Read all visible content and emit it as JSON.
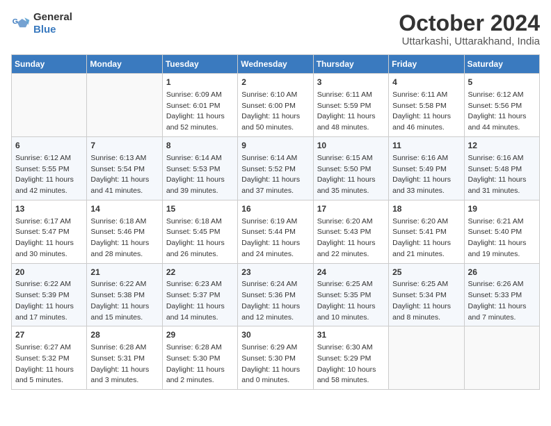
{
  "logo": {
    "line1": "General",
    "line2": "Blue"
  },
  "title": "October 2024",
  "location": "Uttarkashi, Uttarakhand, India",
  "headers": [
    "Sunday",
    "Monday",
    "Tuesday",
    "Wednesday",
    "Thursday",
    "Friday",
    "Saturday"
  ],
  "weeks": [
    [
      {
        "day": "",
        "info": ""
      },
      {
        "day": "",
        "info": ""
      },
      {
        "day": "1",
        "info": "Sunrise: 6:09 AM\nSunset: 6:01 PM\nDaylight: 11 hours and 52 minutes."
      },
      {
        "day": "2",
        "info": "Sunrise: 6:10 AM\nSunset: 6:00 PM\nDaylight: 11 hours and 50 minutes."
      },
      {
        "day": "3",
        "info": "Sunrise: 6:11 AM\nSunset: 5:59 PM\nDaylight: 11 hours and 48 minutes."
      },
      {
        "day": "4",
        "info": "Sunrise: 6:11 AM\nSunset: 5:58 PM\nDaylight: 11 hours and 46 minutes."
      },
      {
        "day": "5",
        "info": "Sunrise: 6:12 AM\nSunset: 5:56 PM\nDaylight: 11 hours and 44 minutes."
      }
    ],
    [
      {
        "day": "6",
        "info": "Sunrise: 6:12 AM\nSunset: 5:55 PM\nDaylight: 11 hours and 42 minutes."
      },
      {
        "day": "7",
        "info": "Sunrise: 6:13 AM\nSunset: 5:54 PM\nDaylight: 11 hours and 41 minutes."
      },
      {
        "day": "8",
        "info": "Sunrise: 6:14 AM\nSunset: 5:53 PM\nDaylight: 11 hours and 39 minutes."
      },
      {
        "day": "9",
        "info": "Sunrise: 6:14 AM\nSunset: 5:52 PM\nDaylight: 11 hours and 37 minutes."
      },
      {
        "day": "10",
        "info": "Sunrise: 6:15 AM\nSunset: 5:50 PM\nDaylight: 11 hours and 35 minutes."
      },
      {
        "day": "11",
        "info": "Sunrise: 6:16 AM\nSunset: 5:49 PM\nDaylight: 11 hours and 33 minutes."
      },
      {
        "day": "12",
        "info": "Sunrise: 6:16 AM\nSunset: 5:48 PM\nDaylight: 11 hours and 31 minutes."
      }
    ],
    [
      {
        "day": "13",
        "info": "Sunrise: 6:17 AM\nSunset: 5:47 PM\nDaylight: 11 hours and 30 minutes."
      },
      {
        "day": "14",
        "info": "Sunrise: 6:18 AM\nSunset: 5:46 PM\nDaylight: 11 hours and 28 minutes."
      },
      {
        "day": "15",
        "info": "Sunrise: 6:18 AM\nSunset: 5:45 PM\nDaylight: 11 hours and 26 minutes."
      },
      {
        "day": "16",
        "info": "Sunrise: 6:19 AM\nSunset: 5:44 PM\nDaylight: 11 hours and 24 minutes."
      },
      {
        "day": "17",
        "info": "Sunrise: 6:20 AM\nSunset: 5:43 PM\nDaylight: 11 hours and 22 minutes."
      },
      {
        "day": "18",
        "info": "Sunrise: 6:20 AM\nSunset: 5:41 PM\nDaylight: 11 hours and 21 minutes."
      },
      {
        "day": "19",
        "info": "Sunrise: 6:21 AM\nSunset: 5:40 PM\nDaylight: 11 hours and 19 minutes."
      }
    ],
    [
      {
        "day": "20",
        "info": "Sunrise: 6:22 AM\nSunset: 5:39 PM\nDaylight: 11 hours and 17 minutes."
      },
      {
        "day": "21",
        "info": "Sunrise: 6:22 AM\nSunset: 5:38 PM\nDaylight: 11 hours and 15 minutes."
      },
      {
        "day": "22",
        "info": "Sunrise: 6:23 AM\nSunset: 5:37 PM\nDaylight: 11 hours and 14 minutes."
      },
      {
        "day": "23",
        "info": "Sunrise: 6:24 AM\nSunset: 5:36 PM\nDaylight: 11 hours and 12 minutes."
      },
      {
        "day": "24",
        "info": "Sunrise: 6:25 AM\nSunset: 5:35 PM\nDaylight: 11 hours and 10 minutes."
      },
      {
        "day": "25",
        "info": "Sunrise: 6:25 AM\nSunset: 5:34 PM\nDaylight: 11 hours and 8 minutes."
      },
      {
        "day": "26",
        "info": "Sunrise: 6:26 AM\nSunset: 5:33 PM\nDaylight: 11 hours and 7 minutes."
      }
    ],
    [
      {
        "day": "27",
        "info": "Sunrise: 6:27 AM\nSunset: 5:32 PM\nDaylight: 11 hours and 5 minutes."
      },
      {
        "day": "28",
        "info": "Sunrise: 6:28 AM\nSunset: 5:31 PM\nDaylight: 11 hours and 3 minutes."
      },
      {
        "day": "29",
        "info": "Sunrise: 6:28 AM\nSunset: 5:30 PM\nDaylight: 11 hours and 2 minutes."
      },
      {
        "day": "30",
        "info": "Sunrise: 6:29 AM\nSunset: 5:30 PM\nDaylight: 11 hours and 0 minutes."
      },
      {
        "day": "31",
        "info": "Sunrise: 6:30 AM\nSunset: 5:29 PM\nDaylight: 10 hours and 58 minutes."
      },
      {
        "day": "",
        "info": ""
      },
      {
        "day": "",
        "info": ""
      }
    ]
  ]
}
